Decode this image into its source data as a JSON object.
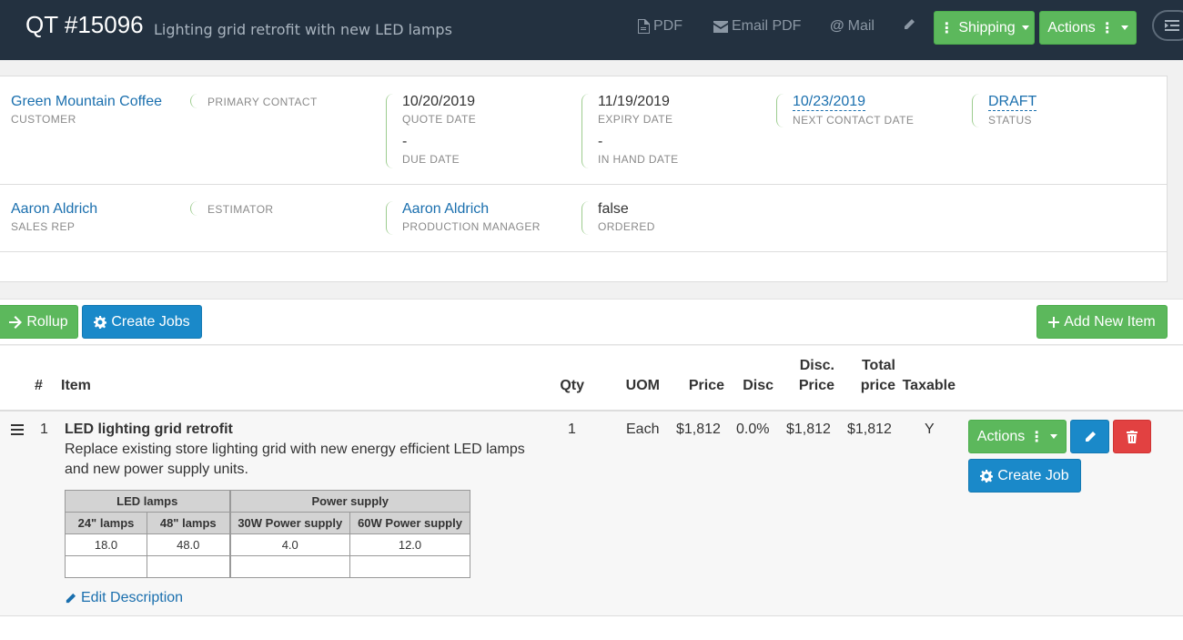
{
  "header": {
    "title": "QT #15096",
    "subtitle": "Lighting grid retrofit with new LED lamps",
    "links": {
      "pdf": "PDF",
      "email_pdf": "Email PDF",
      "mail": "Mail"
    },
    "shipping_label": "Shipping",
    "actions_label": "Actions"
  },
  "info": {
    "customer": {
      "value": "Green Mountain Coffee",
      "label": "CUSTOMER"
    },
    "primary_contact": {
      "label": "PRIMARY CONTACT"
    },
    "quote_date": {
      "value": "10/20/2019",
      "label": "QUOTE DATE"
    },
    "due_date": {
      "value": "-",
      "label": "DUE DATE"
    },
    "expiry_date": {
      "value": "11/19/2019",
      "label": "EXPIRY DATE"
    },
    "in_hand_date": {
      "value": "-",
      "label": "IN HAND DATE"
    },
    "next_contact_date": {
      "value": "10/23/2019",
      "label": "NEXT CONTACT DATE"
    },
    "status": {
      "value": "DRAFT",
      "label": "STATUS"
    },
    "sales_rep": {
      "value": "Aaron Aldrich",
      "label": "SALES REP"
    },
    "estimator": {
      "label": "ESTIMATOR"
    },
    "production_manager": {
      "value": "Aaron Aldrich",
      "label": "PRODUCTION MANAGER"
    },
    "ordered": {
      "value": "false",
      "label": "ORDERED"
    }
  },
  "toolbar": {
    "rollup_label": "Rollup",
    "create_jobs_label": "Create Jobs",
    "add_item_label": "Add New Item"
  },
  "table": {
    "headers": {
      "num": "#",
      "item": "Item",
      "qty": "Qty",
      "uom": "UOM",
      "price": "Price",
      "disc": "Disc",
      "disc_price_1": "Disc.",
      "disc_price_2": "Price",
      "total_price_1": "Total",
      "total_price_2": "price",
      "taxable": "Taxable"
    },
    "rows": [
      {
        "num": "1",
        "name": "LED lighting grid retrofit",
        "description": "Replace existing store lighting grid with new energy efficient LED lamps and new power supply units.",
        "qty": "1",
        "uom": "Each",
        "price": "$1,812",
        "disc": "0.0%",
        "disc_price": "$1,812",
        "total_price": "$1,812",
        "taxable": "Y",
        "actions_label": "Actions",
        "create_job_label": "Create Job",
        "edit_description_label": "Edit Description",
        "spec": {
          "groups": [
            "LED lamps",
            "Power supply"
          ],
          "columns": [
            "24\" lamps",
            "48\" lamps",
            "30W Power supply",
            "60W Power supply"
          ],
          "values": [
            "18.0",
            "48.0",
            "4.0",
            "12.0"
          ]
        }
      }
    ]
  },
  "colors": {
    "header_bg": "#233140",
    "green": "#5cb85c",
    "blue": "#1a89c9",
    "red": "#e24141",
    "link": "#1a6fae"
  }
}
